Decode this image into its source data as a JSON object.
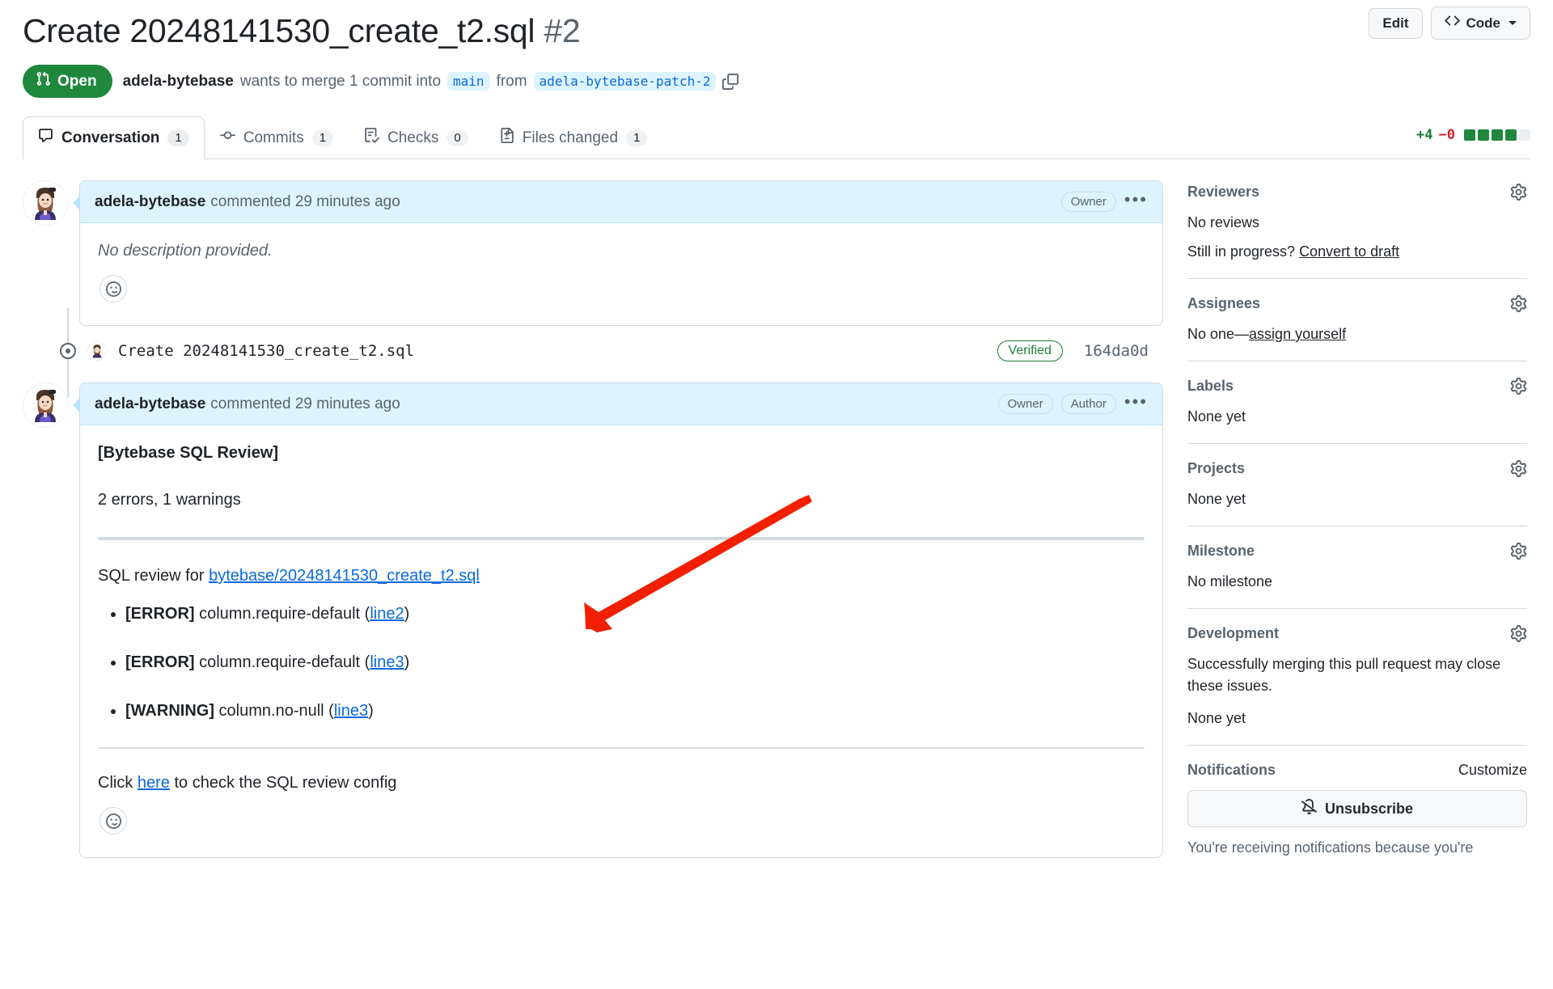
{
  "header": {
    "title_main": "Create 20248141530_create_t2.sql",
    "title_number": "#2",
    "edit_label": "Edit",
    "code_label": "Code",
    "state": "Open",
    "author": "adela-bytebase",
    "merge_text": "wants to merge 1 commit into",
    "base_branch": "main",
    "from_word": "from",
    "head_branch": "adela-bytebase-patch-2"
  },
  "tabs": [
    {
      "label": "Conversation",
      "count": "1",
      "icon": "comment-icon",
      "active": true
    },
    {
      "label": "Commits",
      "count": "1",
      "icon": "commit-icon",
      "active": false
    },
    {
      "label": "Checks",
      "count": "0",
      "icon": "checklist-icon",
      "active": false
    },
    {
      "label": "Files changed",
      "count": "1",
      "icon": "file-diff-icon",
      "active": false
    }
  ],
  "diffstat": {
    "additions": "+4",
    "deletions": "−0",
    "blocks_on": 4,
    "blocks_off": 1
  },
  "comments": [
    {
      "author": "adela-bytebase",
      "meta": "commented 29 minutes ago",
      "badges": [
        "Owner"
      ],
      "body_italic": "No description provided."
    },
    {
      "author": "adela-bytebase",
      "meta": "commented 29 minutes ago",
      "badges": [
        "Owner",
        "Author"
      ],
      "review_title": "[Bytebase SQL Review]",
      "review_summary": "2 errors, 1 warnings",
      "review_for_prefix": "SQL review for ",
      "review_for_link": "bytebase/20248141530_create_t2.sql",
      "issues": [
        {
          "severity": "[ERROR]",
          "rule": "column.require-default",
          "line": "line2"
        },
        {
          "severity": "[ERROR]",
          "rule": "column.require-default",
          "line": "line3"
        },
        {
          "severity": "[WARNING]",
          "rule": "column.no-null",
          "line": "line3"
        }
      ],
      "footer_prefix": "Click ",
      "footer_link": "here",
      "footer_suffix": " to check the SQL review config"
    }
  ],
  "commit": {
    "message": "Create 20248141530_create_t2.sql",
    "verified_label": "Verified",
    "sha": "164da0d"
  },
  "sidebar": {
    "reviewers": {
      "title": "Reviewers",
      "body": "No reviews",
      "draft_prefix": "Still in progress? ",
      "draft_link": "Convert to draft"
    },
    "assignees": {
      "title": "Assignees",
      "body_prefix": "No one—",
      "body_link": "assign yourself"
    },
    "labels": {
      "title": "Labels",
      "body": "None yet"
    },
    "projects": {
      "title": "Projects",
      "body": "None yet"
    },
    "milestone": {
      "title": "Milestone",
      "body": "No milestone"
    },
    "development": {
      "title": "Development",
      "body": "Successfully merging this pull request may close these issues.",
      "none": "None yet"
    },
    "notifications": {
      "title": "Notifications",
      "customize": "Customize",
      "unsubscribe": "Unsubscribe",
      "note": "You're receiving notifications because you're"
    }
  },
  "annotation": {
    "color": "#F22000",
    "shape": "arrow-pointing-down-left"
  }
}
